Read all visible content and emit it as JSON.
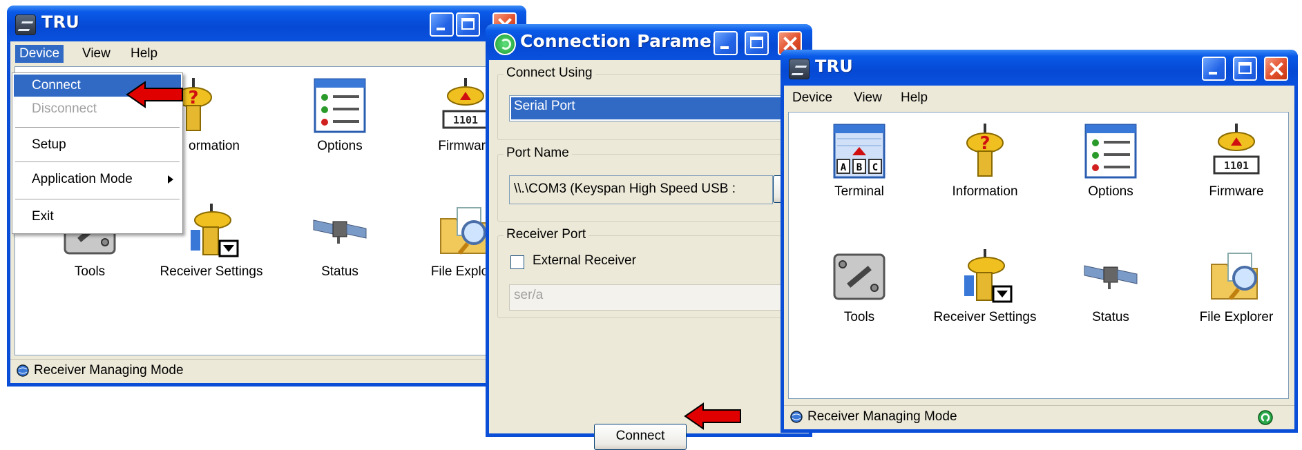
{
  "window1": {
    "title": "TRU",
    "menu": [
      "Device",
      "View",
      "Help"
    ],
    "dropdown": {
      "connect": "Connect",
      "disconnect": "Disconnect",
      "setup": "Setup",
      "app_mode": "Application Mode",
      "exit": "Exit"
    },
    "items": {
      "information_partial": "ormation",
      "options": "Options",
      "firmware_partial": "Firmware",
      "tools": "Tools",
      "receiver_settings": "Receiver Settings",
      "status": "Status",
      "file_explorer_partial": "File Explore"
    },
    "status": "Receiver Managing Mode"
  },
  "dialog": {
    "title": "Connection Parame...",
    "connect_using": {
      "label": "Connect Using",
      "value": "Serial Port"
    },
    "port_name": {
      "label": "Port Name",
      "value": "\\\\.\\COM3 (Keyspan High Speed USB :",
      "browse": "..."
    },
    "receiver_port": {
      "label": "Receiver Port",
      "external": "External Receiver",
      "value": "ser/a"
    },
    "connect_button": "Connect"
  },
  "window2": {
    "title": "TRU",
    "menu": [
      "Device",
      "View",
      "Help"
    ],
    "items": {
      "terminal": "Terminal",
      "information": "Information",
      "options": "Options",
      "firmware": "Firmware",
      "tools": "Tools",
      "receiver_settings": "Receiver Settings",
      "status": "Status",
      "file_explorer": "File Explorer"
    },
    "status": "Receiver Managing Mode"
  },
  "icons": {
    "information": "info-gps-icon",
    "options": "options-list-icon",
    "firmware": "firmware-chip-icon",
    "terminal": "terminal-abc-icon",
    "tools": "wrench-tools-icon",
    "receiver_settings": "receiver-settings-icon",
    "status": "satellite-icon",
    "file_explorer": "folder-magnifier-icon"
  },
  "colors": {
    "xp_blue": "#0a4ed8",
    "highlight": "#316ac5",
    "arrow_red": "#e00000",
    "window_bg": "#ece9d8"
  }
}
